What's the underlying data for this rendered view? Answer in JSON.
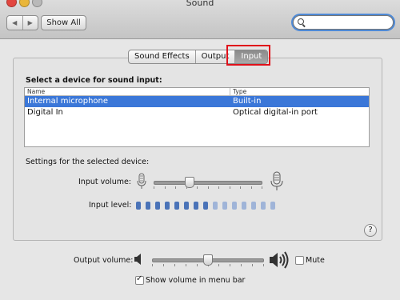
{
  "window": {
    "title": "Sound"
  },
  "toolbar": {
    "back_icon": "chevron-left-icon",
    "forward_icon": "chevron-right-icon",
    "show_all": "Show All",
    "search_placeholder": "",
    "traffic_colors": [
      "#e2463f",
      "#e9b63a",
      "#b9b9b9"
    ]
  },
  "tabs": [
    {
      "label": "Sound Effects",
      "active": false
    },
    {
      "label": "Output",
      "active": false
    },
    {
      "label": "Input",
      "active": true
    }
  ],
  "input": {
    "heading": "Select a device for sound input:",
    "columns": {
      "name": "Name",
      "type": "Type"
    },
    "devices": [
      {
        "name": "Internal microphone",
        "type": "Built-in",
        "selected": true
      },
      {
        "name": "Digital In",
        "type": "Optical digital-in port",
        "selected": false
      }
    ],
    "settings_heading": "Settings for the selected device:",
    "volume_label": "Input volume:",
    "volume_value": 0.33,
    "level_label": "Input level:",
    "level_segments": 15
  },
  "output": {
    "volume_label": "Output volume:",
    "volume_value": 0.5,
    "mute_label": "Mute",
    "mute_checked": false,
    "show_volume_label": "Show volume in menu bar",
    "show_volume_checked": true
  },
  "help_label": "?",
  "accent": "#3b77d8",
  "highlight_box_color": "#e0101a"
}
